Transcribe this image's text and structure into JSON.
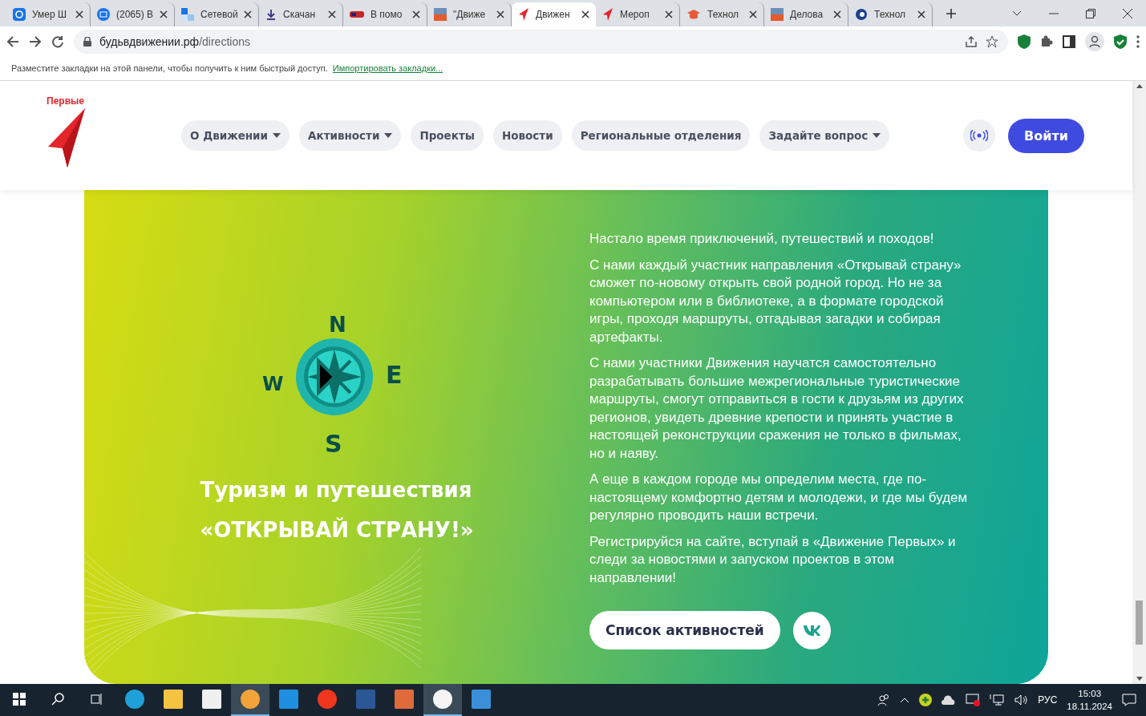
{
  "browser": {
    "tabs": [
      {
        "title": "Умер Ш",
        "selected": false
      },
      {
        "title": "(2065) В",
        "selected": false
      },
      {
        "title": "Сетевой",
        "selected": false
      },
      {
        "title": "Скачан",
        "selected": false
      },
      {
        "title": "В помо",
        "selected": false
      },
      {
        "title": "\"Движе",
        "selected": false
      },
      {
        "title": "Движен",
        "selected": true
      },
      {
        "title": "Мероп",
        "selected": false
      },
      {
        "title": "Технол",
        "selected": false
      },
      {
        "title": "Делова",
        "selected": false
      },
      {
        "title": "Технол",
        "selected": false
      }
    ],
    "url_host": "будьвдвижении.рф",
    "url_path": "/directions",
    "bookmarks_hint": "Разместите закладки на этой панели, чтобы получить к ним быстрый доступ.",
    "bookmarks_link": "Импортировать закладки..."
  },
  "site": {
    "logo_text": "Первые",
    "nav": [
      {
        "label": "О Движении",
        "dropdown": true
      },
      {
        "label": "Активности",
        "dropdown": true
      },
      {
        "label": "Проекты",
        "dropdown": false
      },
      {
        "label": "Новости",
        "dropdown": false
      },
      {
        "label": "Региональные отделения",
        "dropdown": false
      },
      {
        "label": "Задайте вопрос",
        "dropdown": true
      }
    ],
    "login": "Войти"
  },
  "banner": {
    "compass_letters": [
      "N",
      "E",
      "S",
      "W"
    ],
    "title_line1": "Туризм и путешествия",
    "title_line2": "«ОТКРЫВАЙ СТРАНУ!»",
    "paragraphs": [
      "Настало время приключений, путешествий и походов!",
      "С нами каждый участник направления «Открывай страну» сможет по-новому открыть свой родной город. Но не за компьютером или в библиотеке, а в формате городской игры, проходя маршруты, отгадывая загадки и собирая артефакты.",
      "С нами участники Движения научатся самостоятельно разрабатывать большие межрегиональные туристические маршруты, смогут отправиться в гости к друзьям из других регионов, увидеть древние крепости и принять участие в настоящей реконструкции сражения не только в фильмах, но и наяву.",
      "А еще в каждом городе мы определим места, где по-настоящему комфортно детям и молодежи, и где мы будем регулярно проводить наши встречи.",
      "Регистрируйся на сайте, вступай в «Движение Первых» и следи за новостями и запуском проектов в этом направлении!"
    ],
    "button": "Список активностей"
  },
  "taskbar": {
    "apps": [
      {
        "kind": "edge",
        "active": false
      },
      {
        "kind": "folder",
        "active": false
      },
      {
        "kind": "store",
        "active": false
      },
      {
        "kind": "vpn",
        "active": true
      },
      {
        "kind": "mail",
        "active": false
      },
      {
        "kind": "yandex",
        "active": false
      },
      {
        "kind": "word",
        "active": false
      },
      {
        "kind": "ppt",
        "active": false
      },
      {
        "kind": "ybrowser",
        "active": true
      },
      {
        "kind": "photos",
        "active": false
      }
    ],
    "language": "РУС",
    "time": "15:03",
    "date": "18.11.2024"
  }
}
